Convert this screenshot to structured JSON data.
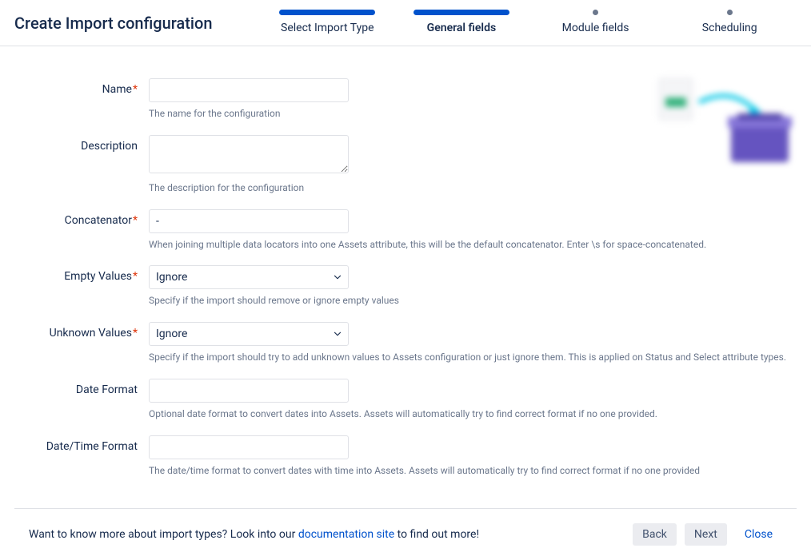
{
  "header": {
    "title": "Create Import configuration",
    "steps": [
      {
        "label": "Select Import Type",
        "state": "done"
      },
      {
        "label": "General fields",
        "state": "active"
      },
      {
        "label": "Module fields",
        "state": "pending"
      },
      {
        "label": "Scheduling",
        "state": "pending"
      }
    ]
  },
  "form": {
    "name": {
      "label": "Name",
      "required": true,
      "value": "",
      "help": "The name for the configuration"
    },
    "description": {
      "label": "Description",
      "required": false,
      "value": "",
      "help": "The description for the configuration"
    },
    "concatenator": {
      "label": "Concatenator",
      "required": true,
      "value": "-",
      "help": "When joining multiple data locators into one Assets attribute, this will be the default concatenator. Enter \\s for space-concatenated."
    },
    "emptyValues": {
      "label": "Empty Values",
      "required": true,
      "value": "Ignore",
      "help": "Specify if the import should remove or ignore empty values"
    },
    "unknownValues": {
      "label": "Unknown Values",
      "required": true,
      "value": "Ignore",
      "help": "Specify if the import should try to add unknown values to Assets configuration or just ignore them. This is applied on Status and Select attribute types."
    },
    "dateFormat": {
      "label": "Date Format",
      "required": false,
      "value": "",
      "help": "Optional date format to convert dates into Assets. Assets will automatically try to find correct format if no one provided."
    },
    "dateTimeFormat": {
      "label": "Date/Time Format",
      "required": false,
      "value": "",
      "help": "The date/time format to convert dates with time into Assets. Assets will automatically try to find correct format if no one provided"
    }
  },
  "footer": {
    "textBefore": "Want to know more about import types? Look into our ",
    "linkText": "documentation site",
    "textAfter": " to find out more!",
    "buttons": {
      "back": "Back",
      "next": "Next",
      "close": "Close"
    }
  }
}
